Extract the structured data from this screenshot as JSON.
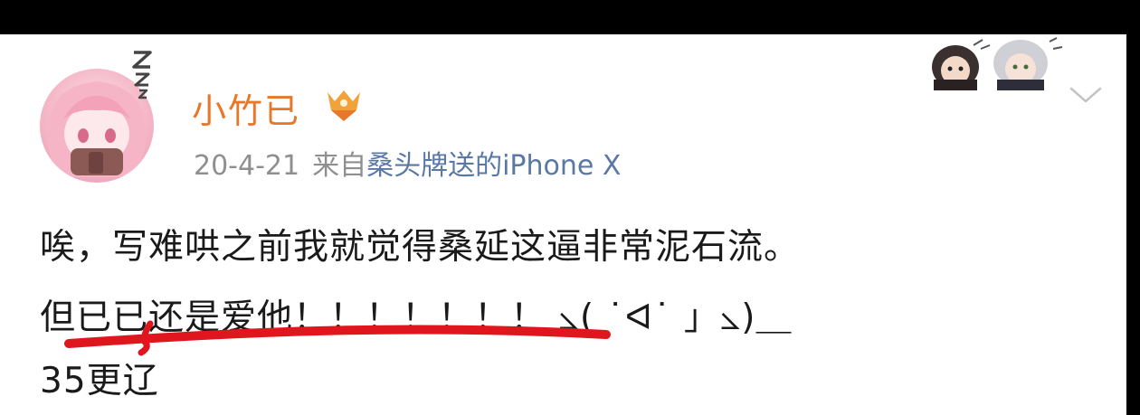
{
  "post": {
    "author": {
      "name": "小竹已"
    },
    "meta": {
      "date": "20-4-21",
      "from_label": "来自",
      "source": "桑头牌送的iPhone X"
    },
    "lines": [
      "唉，写难哄之前我就觉得桑延这逼非常泥石流。",
      "但已已还是爱他！！！！！！！ ⦣( ˙ᐊ˙ 」⦣)＿",
      "35更辽"
    ]
  },
  "icons": {
    "avatar": "avatar-anime-girl",
    "badge": "vip-crown-icon",
    "expand": "chevron-down-icon",
    "sleep": "zz-icon",
    "sticker": "anime-sticker"
  },
  "colors": {
    "username": "#e8772a",
    "meta_text": "#8f8f8f",
    "source_link": "#5a78a6",
    "underline": "#e0161e"
  }
}
